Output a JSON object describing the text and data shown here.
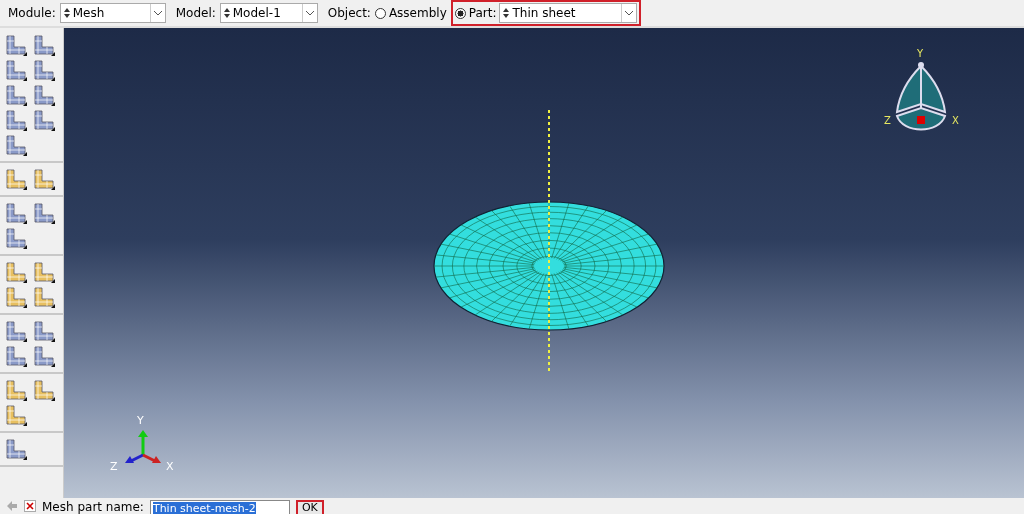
{
  "toolbar": {
    "module": {
      "label": "Module:",
      "value": "Mesh"
    },
    "model": {
      "label": "Model:",
      "value": "Model-1"
    },
    "object": {
      "label": "Object:",
      "options": [
        {
          "label": "Assembly",
          "selected": false
        },
        {
          "label": "Part:",
          "selected": true
        }
      ]
    },
    "part": {
      "value": "Thin sheet"
    }
  },
  "viewport": {
    "view_cube": {
      "y": "Y",
      "z": "Z",
      "x": "X"
    },
    "triad": {
      "y": "Y",
      "z": "Z",
      "x": "X"
    }
  },
  "prompt": {
    "label": "Mesh part name:",
    "value": "Thin sheet-mesh-2",
    "ok": "OK"
  }
}
